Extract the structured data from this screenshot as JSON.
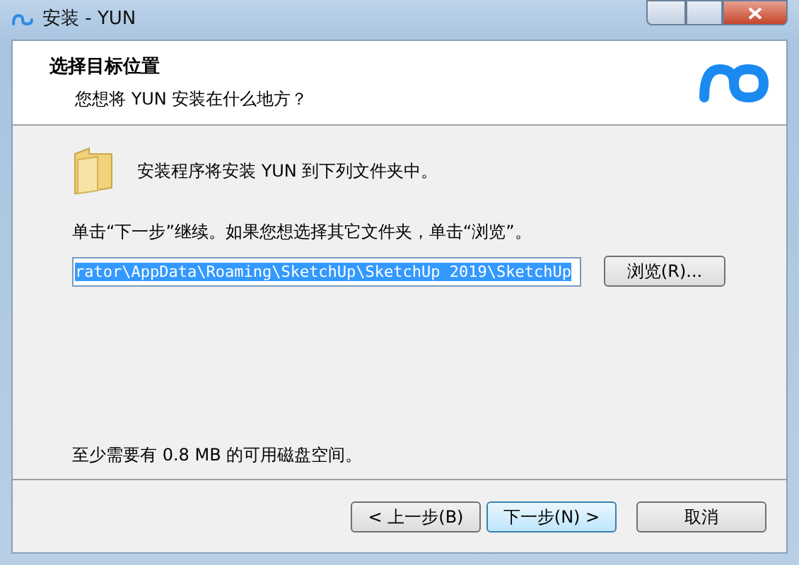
{
  "window": {
    "title": "安装 - YUN"
  },
  "header": {
    "title": "选择目标位置",
    "subtitle": "您想将 YUN 安装在什么地方？"
  },
  "body": {
    "intro": "安装程序将安装 YUN 到下列文件夹中。",
    "instruction": "单击“下一步”继续。如果您想选择其它文件夹，单击“浏览”。",
    "path_field": {
      "value": "rator\\AppData\\Roaming\\SketchUp\\SketchUp 2019\\SketchUp",
      "text_selected": true
    },
    "browse_button": "浏览(R)...",
    "space_note": "至少需要有 0.8 MB 的可用磁盘空间。"
  },
  "buttons": [
    {
      "label": "< 上一步(B)",
      "default": false
    },
    {
      "label": "下一步(N) >",
      "default": true
    },
    {
      "label": "取消",
      "default": false
    }
  ]
}
